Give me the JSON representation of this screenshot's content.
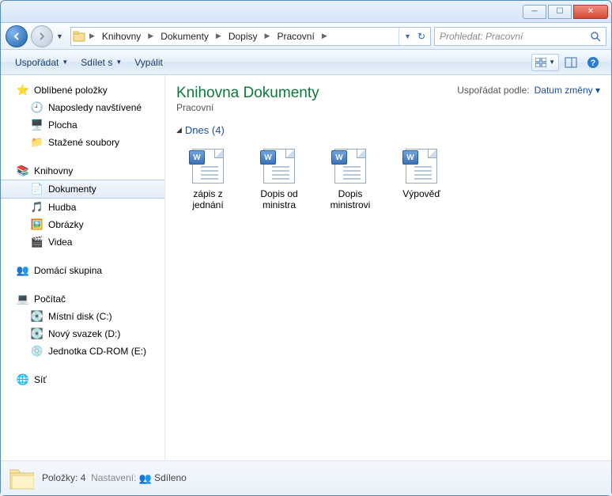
{
  "breadcrumb": {
    "segments": [
      "Knihovny",
      "Dokumenty",
      "Dopisy",
      "Pracovní"
    ]
  },
  "search": {
    "placeholder": "Prohledat: Pracovní"
  },
  "toolbar": {
    "organize": "Uspořádat",
    "share": "Sdílet s",
    "burn": "Vypálit"
  },
  "sidebar": {
    "favorites": {
      "label": "Oblíbené položky",
      "items": [
        "Naposledy navštívené",
        "Plocha",
        "Stažené soubory"
      ]
    },
    "libraries": {
      "label": "Knihovny",
      "items": [
        "Dokumenty",
        "Hudba",
        "Obrázky",
        "Videa"
      ],
      "selected": 0
    },
    "homegroup": {
      "label": "Domácí skupina"
    },
    "computer": {
      "label": "Počítač",
      "items": [
        "Místní disk (C:)",
        "Nový svazek (D:)",
        "Jednotka CD-ROM (E:)"
      ]
    },
    "network": {
      "label": "Síť"
    }
  },
  "library": {
    "title": "Knihovna Dokumenty",
    "subtitle": "Pracovní",
    "arrange_label": "Uspořádat podle:",
    "arrange_value": "Datum změny"
  },
  "group": {
    "label": "Dnes (4)",
    "files": [
      "zápis z jednání",
      "Dopis od ministra",
      "Dopis ministrovi",
      "Výpověď"
    ]
  },
  "status": {
    "items_label": "Položky:",
    "items_count": "4",
    "settings_label": "Nastavení:",
    "settings_value": "Sdíleno"
  }
}
